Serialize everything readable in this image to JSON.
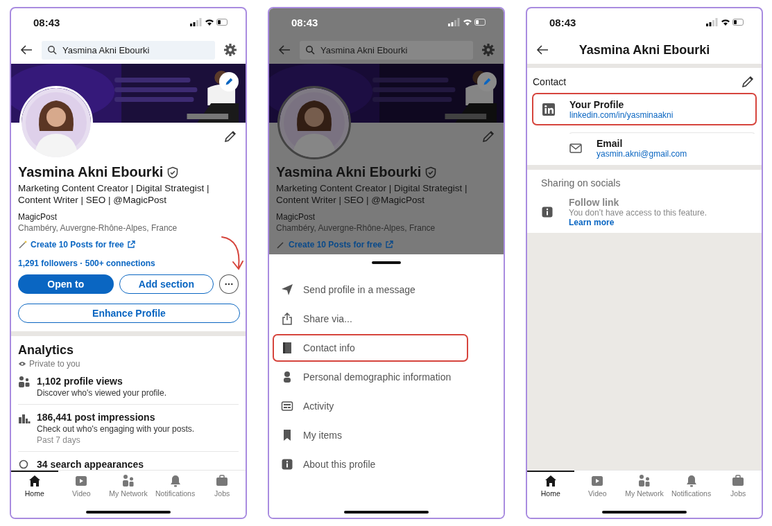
{
  "profile_screen": {
    "status_time": "08:43",
    "search": {
      "value": "Yasmina Akni Ebourki"
    },
    "name": "Yasmina Akni Ebourki",
    "headline": "Marketing Content Creator | Digital Strategist | Content Writer | SEO | @MagicPost",
    "company": "MagicPost",
    "location": "Chambéry, Auvergne-Rhône-Alpes, France",
    "promo_link": "Create 10 Posts for free",
    "network_line": "1,291 followers · 500+ connections",
    "buttons": [
      {
        "kind": "primary",
        "label": "Open to"
      },
      {
        "kind": "secondary",
        "label": "Add section"
      },
      {
        "kind": "more"
      }
    ],
    "wide_button": "Enhance Profile",
    "analytics": {
      "title": "Analytics",
      "privacy": "Private to you",
      "items": [
        {
          "title": "1,102 profile views",
          "subtitle": "Discover who's viewed your profile."
        },
        {
          "title": "186,441 post impressions",
          "subtitle": "Check out who's engaging with your posts.",
          "note": "Past 7 days"
        },
        {
          "title": "34 search appearances"
        }
      ]
    },
    "tabs": [
      {
        "label": "Home",
        "selected": true
      },
      {
        "label": "Video",
        "selected": false
      },
      {
        "label": "My Network",
        "selected": false
      },
      {
        "label": "Notifications",
        "selected": false
      },
      {
        "label": "Jobs",
        "selected": false
      }
    ]
  },
  "menu_screen": {
    "status_time": "08:43",
    "dimmed": true,
    "search": {
      "value": "Yasmina Akni Ebourki"
    },
    "name": "Yasmina Akni Ebourki",
    "headline": "Marketing Content Creator | Digital Strategist | Content Writer | SEO | @MagicPost",
    "company": "MagicPost",
    "location": "Chambéry, Auvergne-Rhône-Alpes, France",
    "promo_link": "Create 10 Posts for free",
    "items": [
      {
        "label": "Send profile in a message",
        "highlighted": false
      },
      {
        "label": "Share via...",
        "highlighted": false
      },
      {
        "label": "Contact info",
        "highlighted": true
      },
      {
        "label": "Personal demographic information",
        "highlighted": false
      },
      {
        "label": "Activity",
        "highlighted": false
      },
      {
        "label": "My items",
        "highlighted": false
      },
      {
        "label": "About this profile",
        "highlighted": false
      }
    ]
  },
  "contact_screen": {
    "status_time": "08:43",
    "title": "Yasmina Akni Ebourki",
    "section_title": "Contact",
    "contacts": [
      {
        "label": "Your Profile",
        "value": "linkedin.com/in/yasminaakni",
        "highlighted": true
      },
      {
        "label": "Email",
        "value": "yasmin.akni@gmail.com",
        "highlighted": false
      }
    ],
    "socials_title": "Sharing on socials",
    "social": {
      "label": "Follow link",
      "description": "You don’t have access to this feature.",
      "link": "Learn more",
      "disabled": true
    },
    "tabs": [
      {
        "label": "Home",
        "selected": true
      },
      {
        "label": "Video",
        "selected": false
      },
      {
        "label": "My Network",
        "selected": false
      },
      {
        "label": "Notifications",
        "selected": false
      },
      {
        "label": "Jobs",
        "selected": false
      }
    ]
  }
}
